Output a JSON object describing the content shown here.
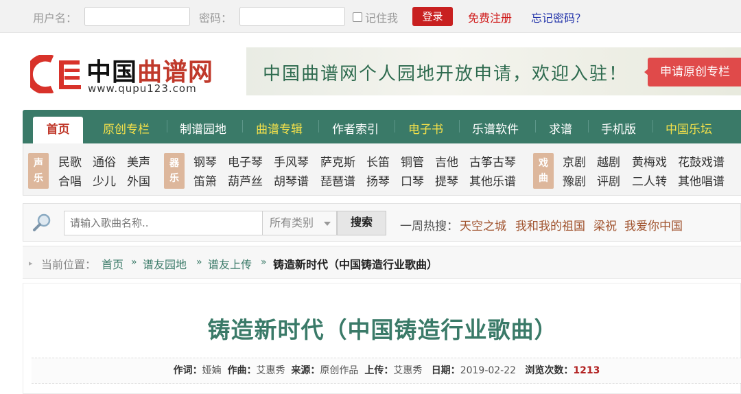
{
  "topbar": {
    "username_label": "用户名：",
    "username_value": "",
    "password_label": "密码：",
    "password_value": "",
    "remember_label": "记住我",
    "login_label": "登录",
    "register_label": "免费注册",
    "forgot_label": "忘记密码？"
  },
  "header": {
    "logo_cn_black": "中国",
    "logo_cn_red": "曲谱网",
    "logo_url": "www.qupu123.com",
    "banner_text": "中国曲谱网个人园地开放申请，欢迎入驻！",
    "banner_button": "申请原创专栏"
  },
  "nav": {
    "items": [
      {
        "label": "首页"
      },
      {
        "label": "原创专栏"
      },
      {
        "label": "制谱园地"
      },
      {
        "label": "曲谱专辑"
      },
      {
        "label": "作者索引"
      },
      {
        "label": "电子书"
      },
      {
        "label": "乐谱软件"
      },
      {
        "label": "求谱"
      },
      {
        "label": "手机版"
      },
      {
        "label": "中国乐坛"
      }
    ]
  },
  "subcat": {
    "vocal": {
      "tag1": "声",
      "tag2": "乐",
      "row1": [
        "民歌",
        "通俗",
        "美声"
      ],
      "row2": [
        "合唱",
        "少儿",
        "外国"
      ]
    },
    "instrument": {
      "tag1": "器",
      "tag2": "乐",
      "row1": [
        "钢琴",
        "电子琴",
        "手风琴",
        "萨克斯",
        "长笛",
        "铜管",
        "吉他",
        "古筝古琴"
      ],
      "row2": [
        "笛箫",
        "葫芦丝",
        "胡琴谱",
        "琵琶谱",
        "扬琴",
        "口琴",
        "提琴",
        "其他乐谱"
      ]
    },
    "opera": {
      "tag1": "戏",
      "tag2": "曲",
      "row1": [
        "京剧",
        "越剧",
        "黄梅戏",
        "花鼓戏谱"
      ],
      "row2": [
        "豫剧",
        "评剧",
        "二人转",
        "其他唱谱"
      ]
    }
  },
  "search": {
    "placeholder": "请输入歌曲名称..",
    "category": "所有类别",
    "button": "搜索",
    "hot_label": "一周热搜：",
    "hot_items": [
      "天空之城",
      "我和我的祖国",
      "梁祝",
      "我爱你中国"
    ]
  },
  "breadcrumb": {
    "label": "当前位置：",
    "items": [
      "首页",
      "谱友园地",
      "谱友上传"
    ],
    "separator": "»",
    "current": "铸造新时代（中国铸造行业歌曲）"
  },
  "article": {
    "title": "铸造新时代（中国铸造行业歌曲）",
    "meta": {
      "lyricist_label": "作词：",
      "lyricist": "娅婻",
      "composer_label": "作曲：",
      "composer": "艾惠秀",
      "source_label": "来源：",
      "source": "原创作品",
      "uploader_label": "上传：",
      "uploader": "艾惠秀",
      "date_label": "日期：",
      "date": "2019-02-22",
      "views_label": "浏览次数：",
      "views": "1213"
    }
  },
  "colors": {
    "brand_green": "#3a7a68",
    "brand_red": "#c82020",
    "nav_gold": "#f5e14a",
    "tag_tan": "#ddb79c"
  }
}
